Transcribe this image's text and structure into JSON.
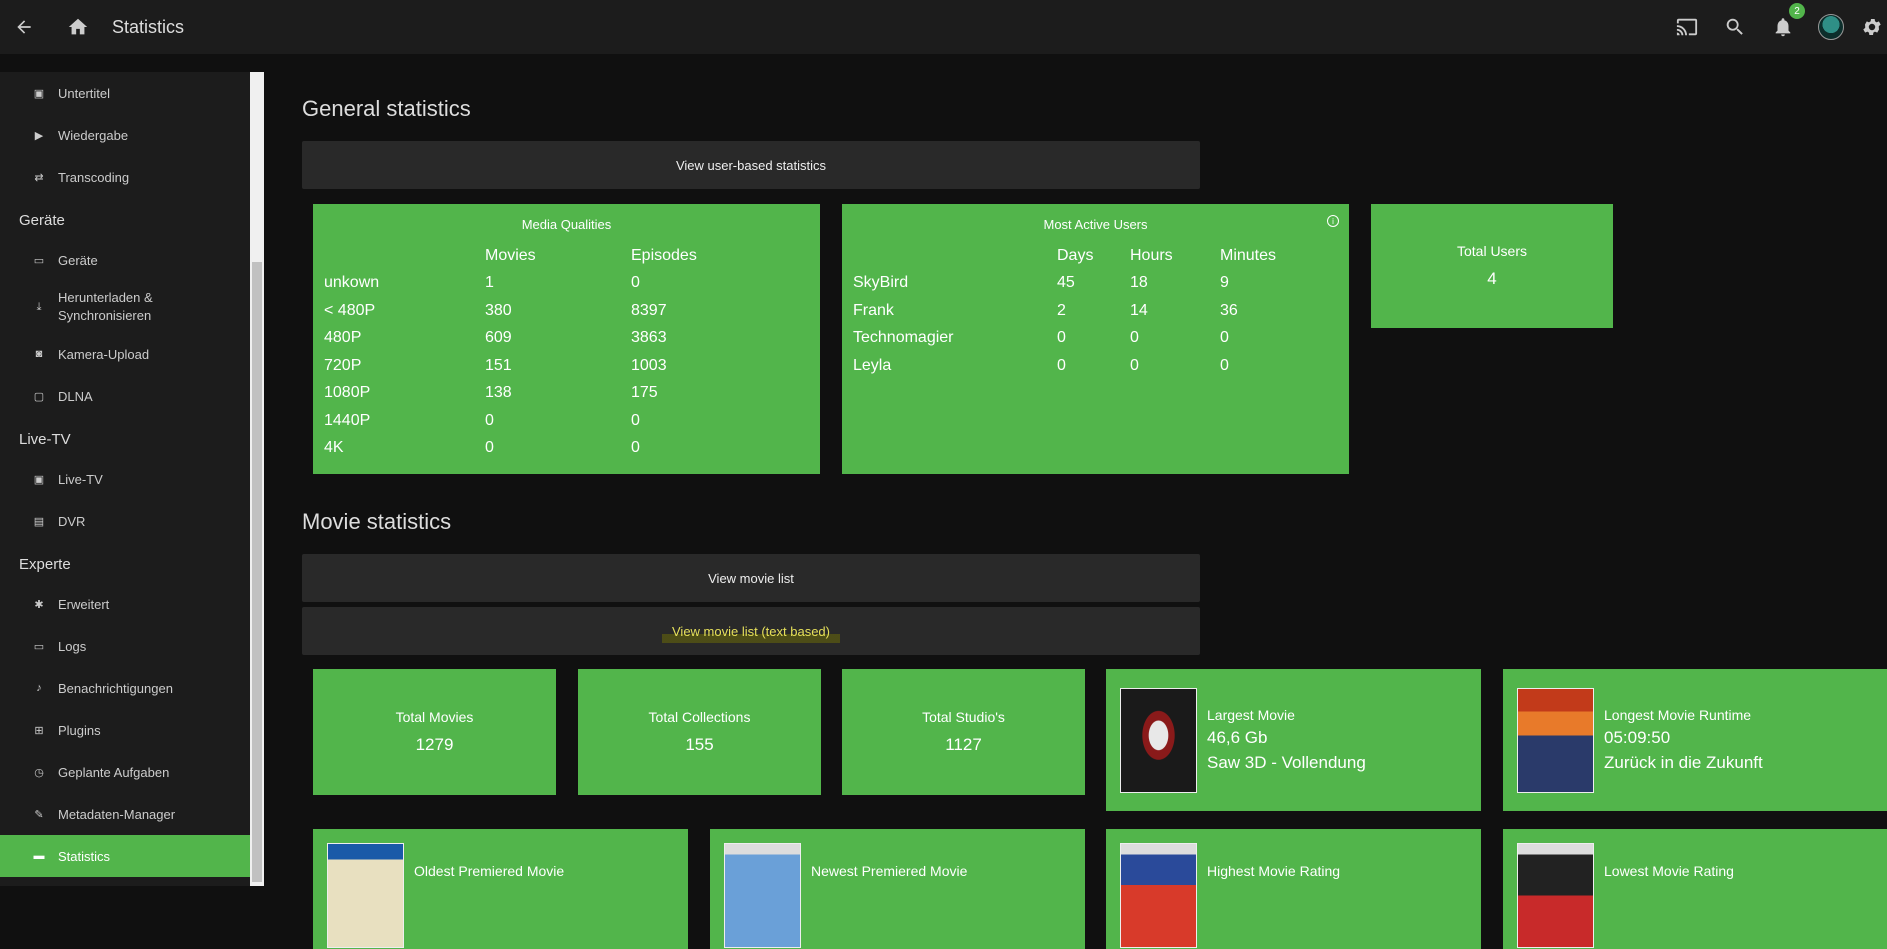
{
  "header": {
    "title": "Statistics",
    "notification_count": "2"
  },
  "sidebar": {
    "items_top": [
      {
        "label": "Untertitel",
        "icon": "subtitles-icon"
      },
      {
        "label": "Wiedergabe",
        "icon": "play-icon"
      },
      {
        "label": "Transcoding",
        "icon": "transcode-icon"
      }
    ],
    "section_devices": "Geräte",
    "items_devices": [
      {
        "label": "Geräte"
      },
      {
        "label": "Herunterladen &\nSynchronisieren"
      },
      {
        "label": "Kamera-Upload"
      },
      {
        "label": "DLNA"
      }
    ],
    "section_livetv": "Live-TV",
    "items_livetv": [
      {
        "label": "Live-TV"
      },
      {
        "label": "DVR"
      }
    ],
    "section_expert": "Experte",
    "items_expert": [
      {
        "label": "Erweitert"
      },
      {
        "label": "Logs"
      },
      {
        "label": "Benachrichtigungen"
      },
      {
        "label": "Plugins"
      },
      {
        "label": "Geplante Aufgaben"
      },
      {
        "label": "Metadaten-Manager"
      },
      {
        "label": "Statistics"
      }
    ]
  },
  "general": {
    "heading": "General statistics",
    "user_button": "View user-based statistics",
    "media_qualities": {
      "title": "Media Qualities",
      "columns": [
        "",
        "Movies",
        "Episodes"
      ],
      "rows": [
        [
          "unkown",
          "1",
          "0"
        ],
        [
          "< 480P",
          "380",
          "8397"
        ],
        [
          "480P",
          "609",
          "3863"
        ],
        [
          "720P",
          "151",
          "1003"
        ],
        [
          "1080P",
          "138",
          "175"
        ],
        [
          "1440P",
          "0",
          "0"
        ],
        [
          "4K",
          "0",
          "0"
        ]
      ]
    },
    "active_users": {
      "title": "Most Active Users",
      "columns": [
        "",
        "Days",
        "Hours",
        "Minutes"
      ],
      "rows": [
        [
          "SkyBird",
          "45",
          "18",
          "9"
        ],
        [
          "Frank",
          "2",
          "14",
          "36"
        ],
        [
          "Technomagier",
          "0",
          "0",
          "0"
        ],
        [
          "Leyla",
          "0",
          "0",
          "0"
        ]
      ]
    },
    "total_users": {
      "label": "Total Users",
      "value": "4"
    }
  },
  "movie": {
    "heading": "Movie statistics",
    "list_button": "View movie list",
    "text_list_button": "View movie list (text based)",
    "total_movies": {
      "label": "Total Movies",
      "value": "1279"
    },
    "total_collections": {
      "label": "Total Collections",
      "value": "155"
    },
    "total_studios": {
      "label": "Total Studio's",
      "value": "1127"
    },
    "largest": {
      "label": "Largest Movie",
      "size": "46,6 Gb",
      "name": "Saw 3D - Vollendung"
    },
    "longest": {
      "label": "Longest Movie Runtime",
      "runtime": "05:09:50",
      "name": "Zurück in die Zukunft"
    },
    "oldest": {
      "label": "Oldest Premiered Movie"
    },
    "newest": {
      "label": "Newest Premiered Movie"
    },
    "highest": {
      "label": "Highest Movie Rating"
    },
    "lowest": {
      "label": "Lowest Movie Rating"
    }
  }
}
